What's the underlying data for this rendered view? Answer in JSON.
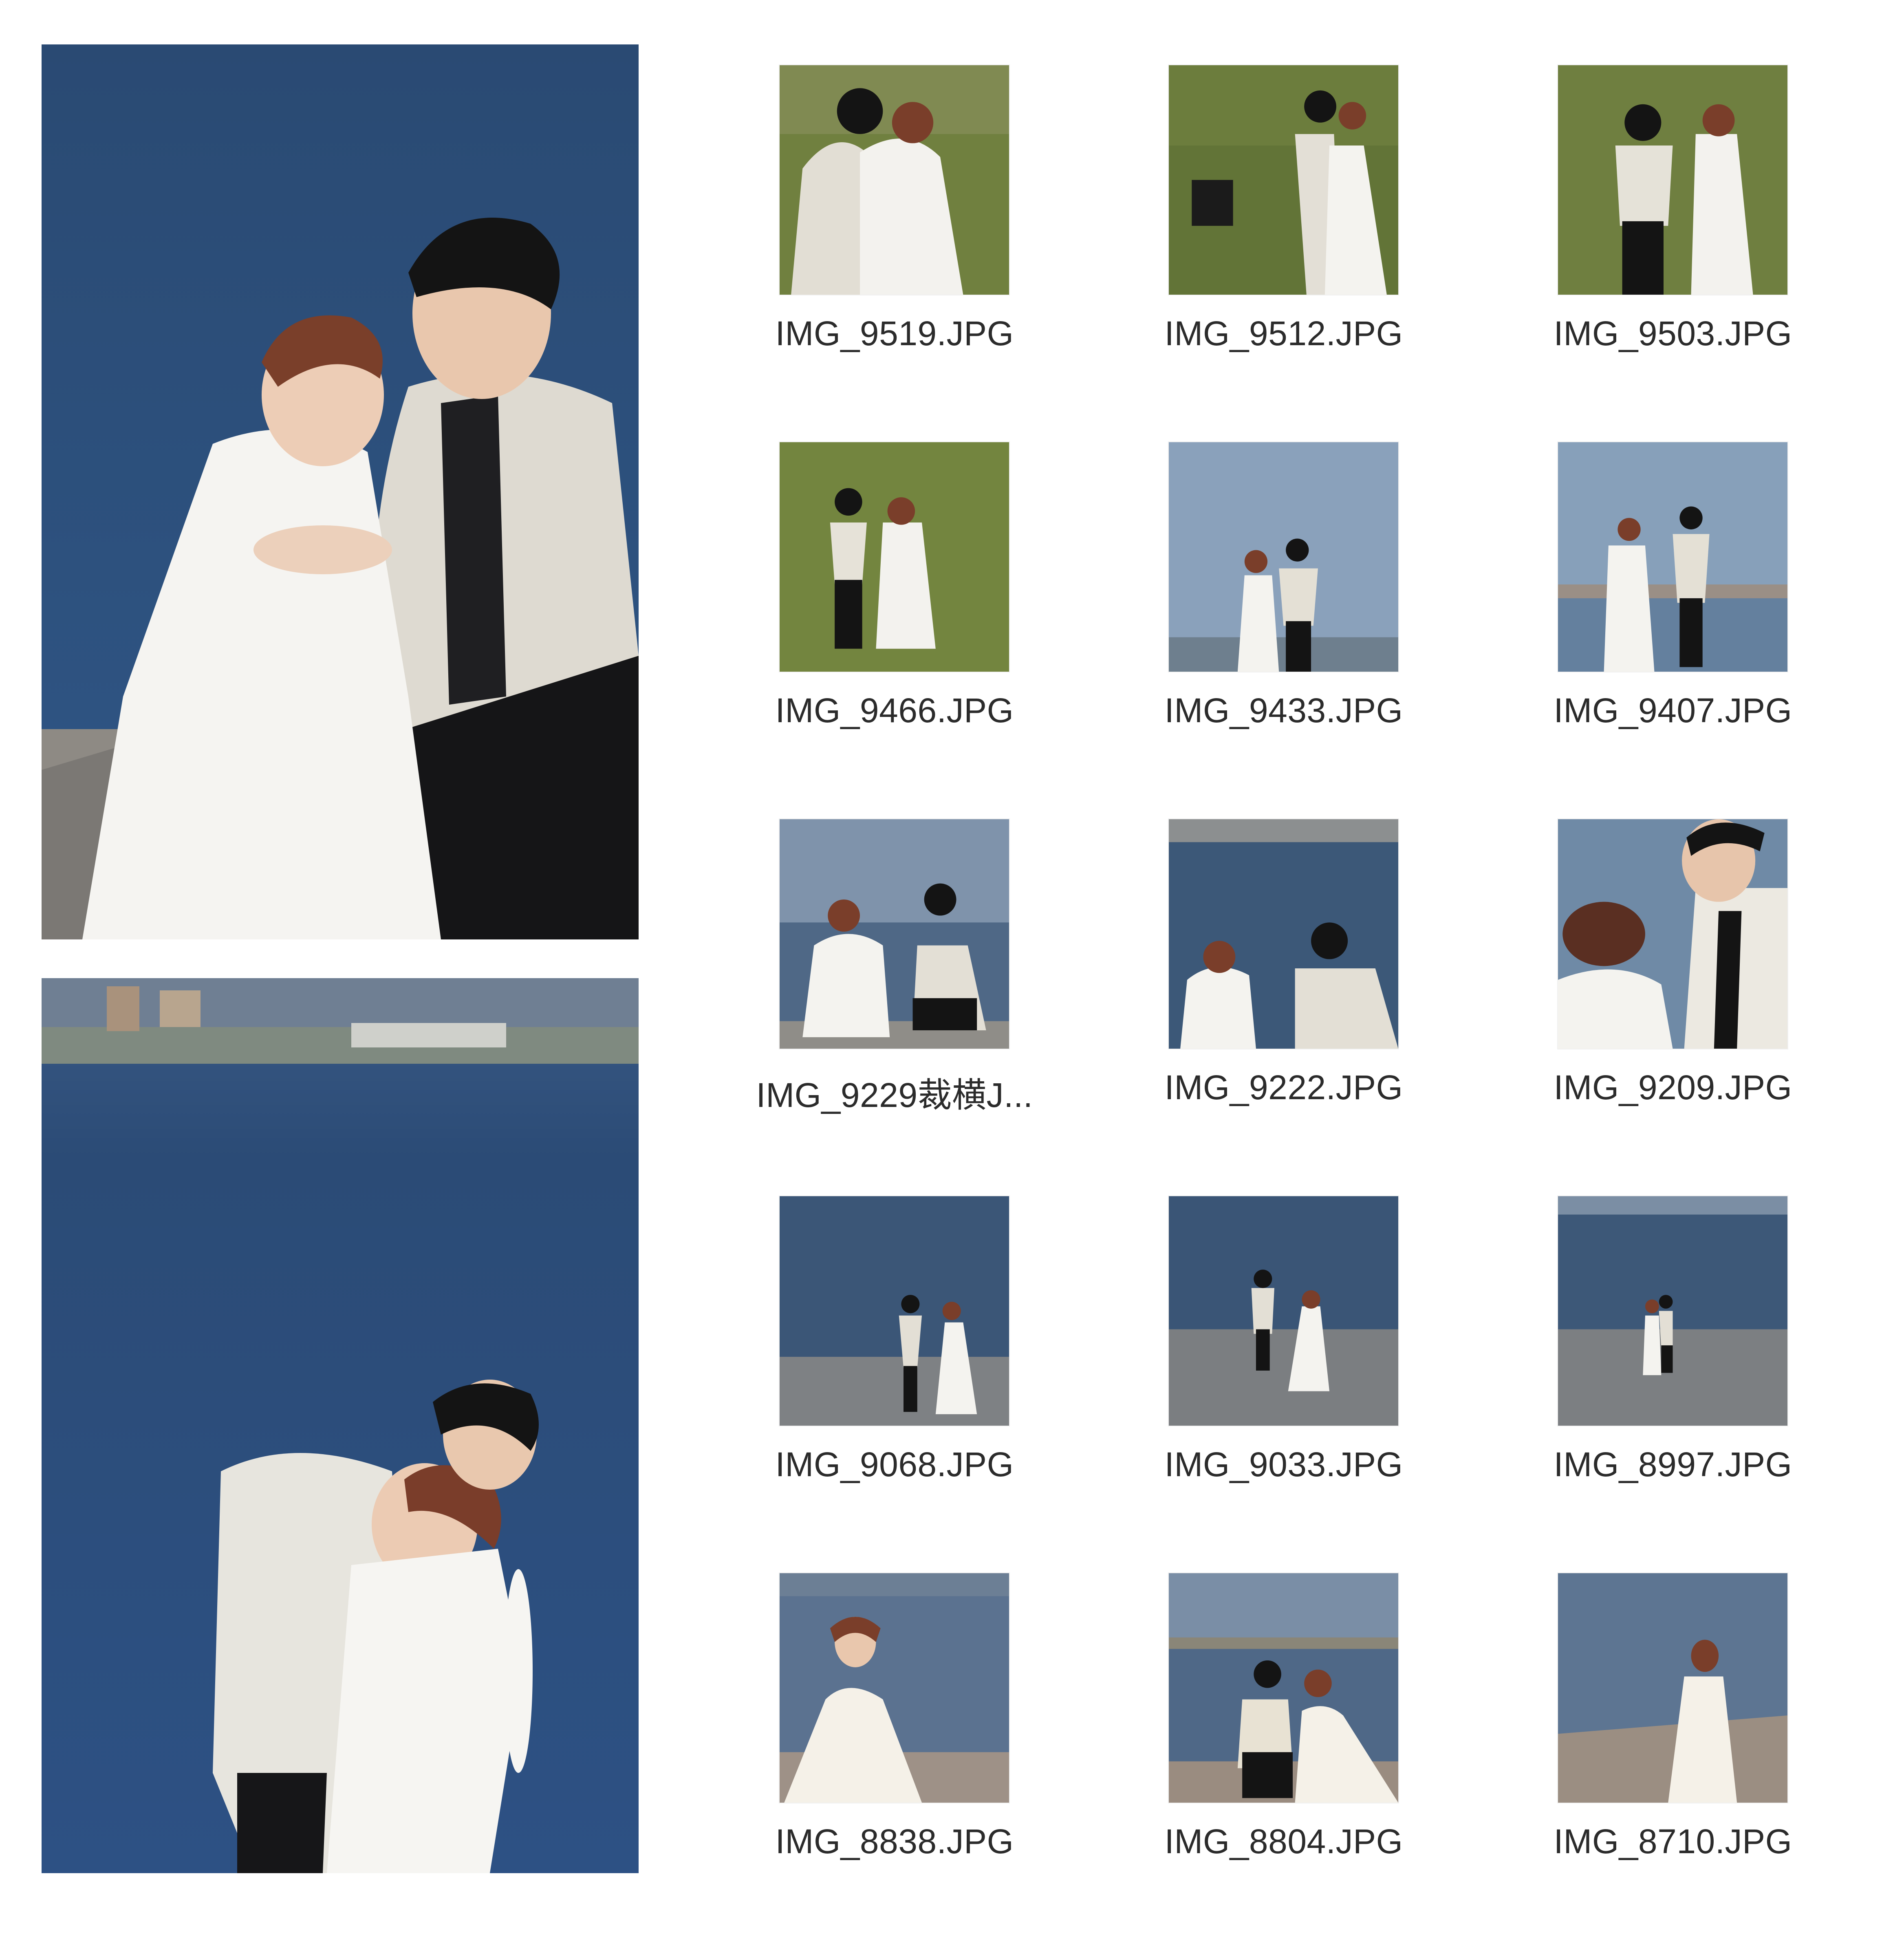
{
  "files": [
    {
      "name": "IMG_9519.JPG",
      "scene": "grass-embrace"
    },
    {
      "name": "IMG_9512.JPG",
      "scene": "grass-behind"
    },
    {
      "name": "IMG_9503.JPG",
      "scene": "grass-apart"
    },
    {
      "name": "IMG_9466.JPG",
      "scene": "grass-hands"
    },
    {
      "name": "IMG_9433.JPG",
      "scene": "sky-standing"
    },
    {
      "name": "IMG_9407.JPG",
      "scene": "sky-standing-city"
    },
    {
      "name": "IMG_9229裁横J...",
      "scene": "water-sitting"
    },
    {
      "name": "IMG_9222.JPG",
      "scene": "water-sitting-close"
    },
    {
      "name": "IMG_9209.JPG",
      "scene": "closeup"
    },
    {
      "name": "IMG_9068.JPG",
      "scene": "pier-walking"
    },
    {
      "name": "IMG_9033.JPG",
      "scene": "pier-walking-far"
    },
    {
      "name": "IMG_8997.JPG",
      "scene": "pier-small"
    },
    {
      "name": "IMG_8838.JPG",
      "scene": "pier-bride"
    },
    {
      "name": "IMG_8804.JPG",
      "scene": "pier-couple-sitting"
    },
    {
      "name": "IMG_8710.JPG",
      "scene": "pier-bride-back"
    }
  ],
  "colors": {
    "sea": "#2f4f78",
    "sky": "#7d95b3",
    "grass": "#6e7f3f",
    "pier": "#8a8d8f",
    "dress": "#f4f3ef",
    "jacket": "#e4e0d6",
    "dark": "#1d1d1f",
    "label": "#2b2b2b"
  }
}
